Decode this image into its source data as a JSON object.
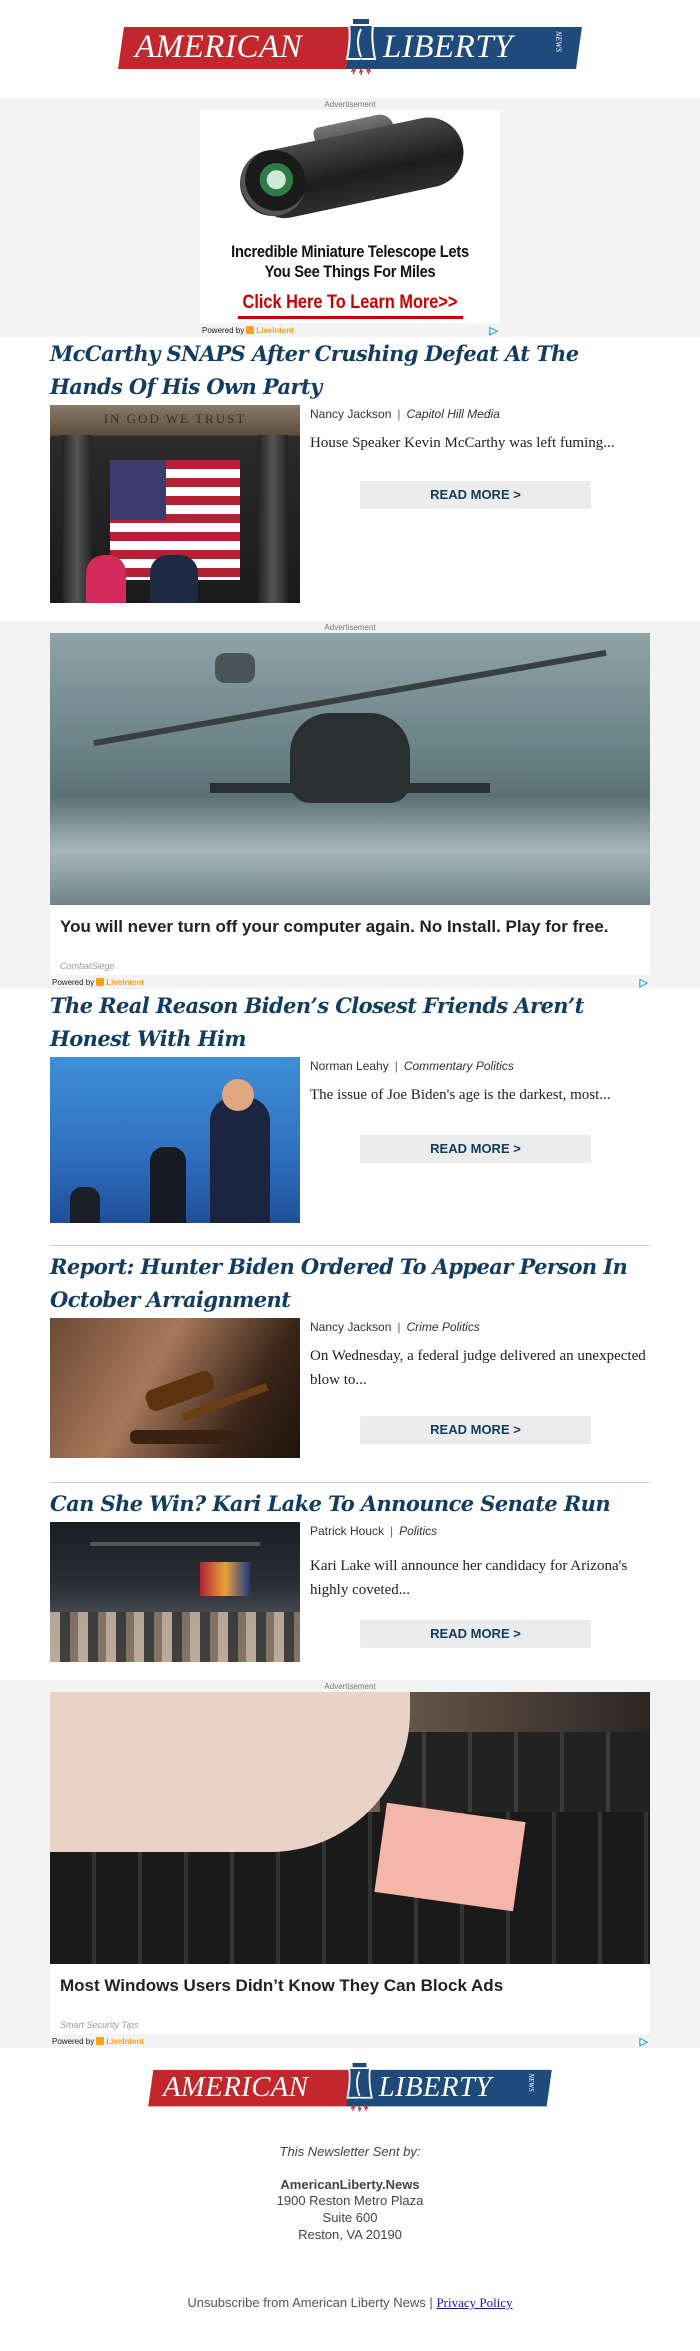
{
  "brand": {
    "word_left": "AMERICAN",
    "word_right": "LIBERTY",
    "tag": "NEWS",
    "colors": {
      "red": "#c1272d",
      "blue": "#1f4a7c",
      "title_blue": "#123d60"
    }
  },
  "ads": [
    {
      "label": "Advertisement",
      "headline": "Incredible Miniature Telescope Lets You See Things For Miles",
      "cta": "Click Here To Learn More>>",
      "powered_by": "Powered by",
      "powered_brand": "LiveIntent",
      "adchoices_icon": "adchoices-icon"
    },
    {
      "label": "Advertisement",
      "headline": "You will never turn off your computer again. No Install. Play for free.",
      "sponsor": "CombatSiege",
      "powered_by": "Powered by",
      "powered_brand": "LiveIntent"
    },
    {
      "label": "Advertisement",
      "headline": "Most Windows Users Didn’t Know They Can Block Ads",
      "sponsor": "Smart Security Tips",
      "powered_by": "Powered by",
      "powered_brand": "LiveIntent"
    }
  ],
  "articles": [
    {
      "title": "McCarthy SNAPS After Crushing Defeat At The Hands Of His Own Party",
      "author": "Nancy Jackson",
      "category": "Capitol Hill Media",
      "excerpt": "House Speaker Kevin McCarthy was left fuming...",
      "image_caption_text": "IN GOD WE TRUST",
      "button": "READ MORE >"
    },
    {
      "title": "The Real Reason Biden’s Closest Friends Aren’t Honest With Him",
      "author": "Norman Leahy",
      "category": "Commentary Politics",
      "excerpt": "The issue of Joe Biden's age is the darkest, most...",
      "button": "READ MORE >"
    },
    {
      "title": "Report: Hunter Biden Ordered To Appear Person In October Arraignment",
      "author": "Nancy Jackson",
      "category": "Crime Politics",
      "excerpt": "On Wednesday, a federal judge delivered an unexpected blow to...",
      "button": "READ MORE >"
    },
    {
      "title": "Can She Win? Kari Lake To Announce Senate Run",
      "author": "Patrick Houck",
      "category": "Politics",
      "excerpt": "Kari Lake will announce her candidacy for Arizona's highly coveted...",
      "button": "READ MORE >"
    }
  ],
  "footer": {
    "sent_by": "This Newsletter Sent by:",
    "org": "AmericanLiberty.News",
    "address_line1": "1900 Reston Metro Plaza",
    "address_line2": "Suite 600",
    "address_line3": "Reston, VA 20190",
    "unsubscribe": "Unsubscribe from American Liberty News",
    "separator": "|",
    "privacy": "Privacy Policy"
  }
}
